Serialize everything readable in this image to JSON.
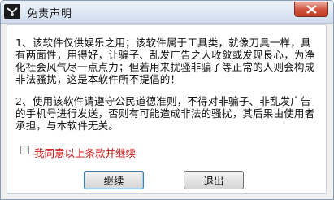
{
  "window": {
    "title": "免责声明",
    "app_icon": "app-icon",
    "close_icon": "close-icon"
  },
  "content": {
    "paragraph1": "1、该软件仅供娱乐之用；该软件属于工具类，就像刀具一样，具有两面性，用得好，让骗子、乱发广告之人收敛或发现良心，为净化社会风气尽一点点力；但若用来扰骚非骗子等正常的人则会构成非法骚扰，这是本软件所不提倡的！",
    "paragraph2": "2、使用该软件请遵守公民道德准则，不得对非骗子、非乱发广告的手机号进行发送，否则有可能造成非法的骚扰，其后果由使用者承担，与本软件无关。"
  },
  "agreement": {
    "label": "我同意以上条款并继续",
    "checked": false
  },
  "buttons": {
    "continue_label": "继续",
    "exit_label": "退出"
  },
  "colors": {
    "agreement_text": "#d01010",
    "close_button": "#c23b22"
  }
}
